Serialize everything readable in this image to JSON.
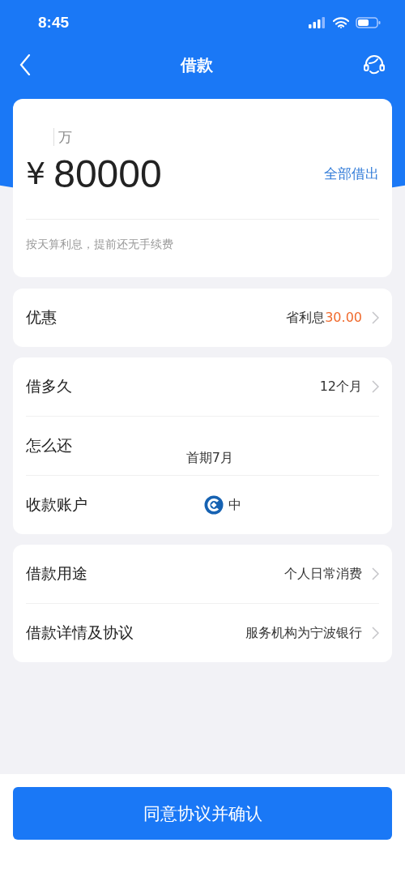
{
  "status_bar": {
    "time": "8:45"
  },
  "nav": {
    "title": "借款"
  },
  "amount_card": {
    "unit": "万",
    "currency": "¥",
    "amount": "80000",
    "action": "全部借出",
    "hint": "按天算利息，提前还无手续费"
  },
  "sections": [
    {
      "rows": [
        {
          "kind": "text",
          "label": "优惠",
          "value": "省利息",
          "highlight": "30.00",
          "chevron": true
        }
      ]
    },
    {
      "rows": [
        {
          "kind": "text",
          "label": "借多久",
          "value": "12个月",
          "chevron": true
        },
        {
          "kind": "lower",
          "label": "怎么还",
          "value": "首期7月",
          "chevron": false
        },
        {
          "kind": "bank",
          "label": "收款账户",
          "value": "中",
          "chevron": false
        }
      ]
    },
    {
      "rows": [
        {
          "kind": "text",
          "label": "借款用途",
          "value": "个人日常消费",
          "chevron": true
        },
        {
          "kind": "text",
          "label": "借款详情及协议",
          "value": "服务机构为宁波银行",
          "chevron": true
        }
      ]
    }
  ],
  "confirm_button": "同意协议并确认"
}
